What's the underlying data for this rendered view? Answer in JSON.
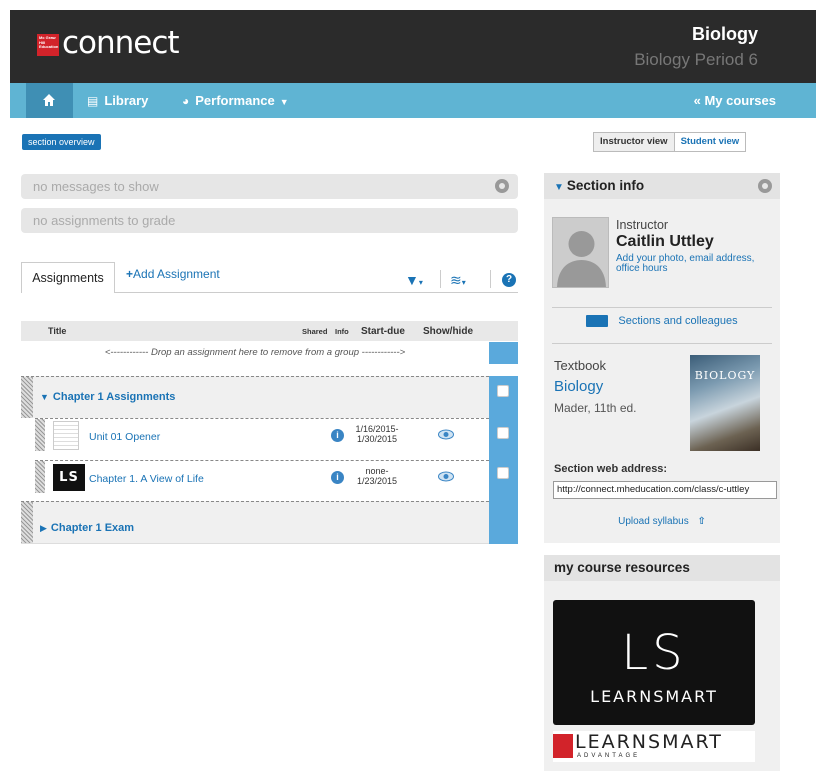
{
  "header": {
    "logo_badge": "Mc Graw Hill Education",
    "logo_text": "connect",
    "course_title": "Biology",
    "course_section": "Biology Period 6"
  },
  "nav": {
    "library": "Library",
    "performance": "Performance",
    "my_courses": "« My courses"
  },
  "section_overview": "section overview",
  "views": {
    "instructor": "Instructor view",
    "student": "Student view"
  },
  "messages": {
    "none_messages": "no messages to show",
    "none_grade": "no assignments to grade"
  },
  "tabs": {
    "assignments": "Assignments",
    "add_assignment": "Add Assignment"
  },
  "table": {
    "headers": {
      "title": "Title",
      "shared": "Shared",
      "info": "Info",
      "start_due": "Start-due",
      "show_hide": "Show/hide"
    },
    "drop_hint": "<------------ Drop an assignment here to remove from a group ------------>",
    "groups": [
      {
        "title": "Chapter 1 Assignments",
        "items": [
          {
            "title": "Unit 01 Opener",
            "start": "1/16/2015-",
            "due": "1/30/2015"
          },
          {
            "title": "Chapter 1. A View of Life",
            "start": "none-",
            "due": "1/23/2015",
            "thumb": "LS"
          }
        ]
      },
      {
        "title": "Chapter 1 Exam",
        "items": []
      }
    ]
  },
  "section_info": {
    "heading": "Section info",
    "instructor_label": "Instructor",
    "instructor_name": "Caitlin Uttley",
    "add_photo_link": "Add your photo, email address, office hours",
    "sections_link": "Sections and colleagues",
    "textbook_label": "Textbook",
    "textbook_title": "Biology",
    "textbook_author": "Mader, 11th ed.",
    "book_cover_title": "BIOLOGY",
    "web_address_label": "Section web address:",
    "web_address": "http://connect.mheducation.com/class/c-uttley",
    "upload_syllabus": "Upload syllabus"
  },
  "resources": {
    "heading": "my course resources",
    "ls_mark": "LS",
    "ls_word": "LEARNSMART",
    "adv_word": "LEARNSMART",
    "adv_sub": "ADVANTAGE"
  },
  "colors": {
    "nav_blue": "#5fb4d3",
    "link_blue": "#1a73b5",
    "header_dark": "#2b2b2b",
    "brand_red": "#d2232a"
  }
}
